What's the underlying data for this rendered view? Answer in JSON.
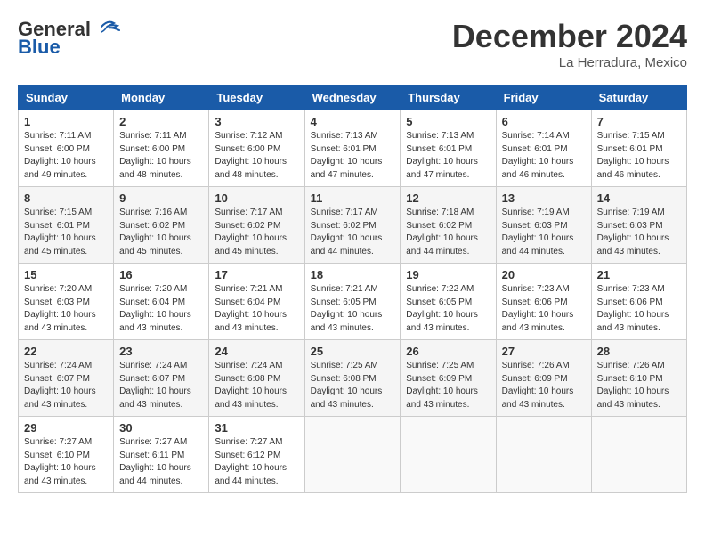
{
  "header": {
    "logo_general": "General",
    "logo_blue": "Blue",
    "month_title": "December 2024",
    "location": "La Herradura, Mexico"
  },
  "weekdays": [
    "Sunday",
    "Monday",
    "Tuesday",
    "Wednesday",
    "Thursday",
    "Friday",
    "Saturday"
  ],
  "weeks": [
    [
      {
        "day": "1",
        "info": "Sunrise: 7:11 AM\nSunset: 6:00 PM\nDaylight: 10 hours\nand 49 minutes."
      },
      {
        "day": "2",
        "info": "Sunrise: 7:11 AM\nSunset: 6:00 PM\nDaylight: 10 hours\nand 48 minutes."
      },
      {
        "day": "3",
        "info": "Sunrise: 7:12 AM\nSunset: 6:00 PM\nDaylight: 10 hours\nand 48 minutes."
      },
      {
        "day": "4",
        "info": "Sunrise: 7:13 AM\nSunset: 6:01 PM\nDaylight: 10 hours\nand 47 minutes."
      },
      {
        "day": "5",
        "info": "Sunrise: 7:13 AM\nSunset: 6:01 PM\nDaylight: 10 hours\nand 47 minutes."
      },
      {
        "day": "6",
        "info": "Sunrise: 7:14 AM\nSunset: 6:01 PM\nDaylight: 10 hours\nand 46 minutes."
      },
      {
        "day": "7",
        "info": "Sunrise: 7:15 AM\nSunset: 6:01 PM\nDaylight: 10 hours\nand 46 minutes."
      }
    ],
    [
      {
        "day": "8",
        "info": "Sunrise: 7:15 AM\nSunset: 6:01 PM\nDaylight: 10 hours\nand 45 minutes."
      },
      {
        "day": "9",
        "info": "Sunrise: 7:16 AM\nSunset: 6:02 PM\nDaylight: 10 hours\nand 45 minutes."
      },
      {
        "day": "10",
        "info": "Sunrise: 7:17 AM\nSunset: 6:02 PM\nDaylight: 10 hours\nand 45 minutes."
      },
      {
        "day": "11",
        "info": "Sunrise: 7:17 AM\nSunset: 6:02 PM\nDaylight: 10 hours\nand 44 minutes."
      },
      {
        "day": "12",
        "info": "Sunrise: 7:18 AM\nSunset: 6:02 PM\nDaylight: 10 hours\nand 44 minutes."
      },
      {
        "day": "13",
        "info": "Sunrise: 7:19 AM\nSunset: 6:03 PM\nDaylight: 10 hours\nand 44 minutes."
      },
      {
        "day": "14",
        "info": "Sunrise: 7:19 AM\nSunset: 6:03 PM\nDaylight: 10 hours\nand 43 minutes."
      }
    ],
    [
      {
        "day": "15",
        "info": "Sunrise: 7:20 AM\nSunset: 6:03 PM\nDaylight: 10 hours\nand 43 minutes."
      },
      {
        "day": "16",
        "info": "Sunrise: 7:20 AM\nSunset: 6:04 PM\nDaylight: 10 hours\nand 43 minutes."
      },
      {
        "day": "17",
        "info": "Sunrise: 7:21 AM\nSunset: 6:04 PM\nDaylight: 10 hours\nand 43 minutes."
      },
      {
        "day": "18",
        "info": "Sunrise: 7:21 AM\nSunset: 6:05 PM\nDaylight: 10 hours\nand 43 minutes."
      },
      {
        "day": "19",
        "info": "Sunrise: 7:22 AM\nSunset: 6:05 PM\nDaylight: 10 hours\nand 43 minutes."
      },
      {
        "day": "20",
        "info": "Sunrise: 7:23 AM\nSunset: 6:06 PM\nDaylight: 10 hours\nand 43 minutes."
      },
      {
        "day": "21",
        "info": "Sunrise: 7:23 AM\nSunset: 6:06 PM\nDaylight: 10 hours\nand 43 minutes."
      }
    ],
    [
      {
        "day": "22",
        "info": "Sunrise: 7:24 AM\nSunset: 6:07 PM\nDaylight: 10 hours\nand 43 minutes."
      },
      {
        "day": "23",
        "info": "Sunrise: 7:24 AM\nSunset: 6:07 PM\nDaylight: 10 hours\nand 43 minutes."
      },
      {
        "day": "24",
        "info": "Sunrise: 7:24 AM\nSunset: 6:08 PM\nDaylight: 10 hours\nand 43 minutes."
      },
      {
        "day": "25",
        "info": "Sunrise: 7:25 AM\nSunset: 6:08 PM\nDaylight: 10 hours\nand 43 minutes."
      },
      {
        "day": "26",
        "info": "Sunrise: 7:25 AM\nSunset: 6:09 PM\nDaylight: 10 hours\nand 43 minutes."
      },
      {
        "day": "27",
        "info": "Sunrise: 7:26 AM\nSunset: 6:09 PM\nDaylight: 10 hours\nand 43 minutes."
      },
      {
        "day": "28",
        "info": "Sunrise: 7:26 AM\nSunset: 6:10 PM\nDaylight: 10 hours\nand 43 minutes."
      }
    ],
    [
      {
        "day": "29",
        "info": "Sunrise: 7:27 AM\nSunset: 6:10 PM\nDaylight: 10 hours\nand 43 minutes."
      },
      {
        "day": "30",
        "info": "Sunrise: 7:27 AM\nSunset: 6:11 PM\nDaylight: 10 hours\nand 44 minutes."
      },
      {
        "day": "31",
        "info": "Sunrise: 7:27 AM\nSunset: 6:12 PM\nDaylight: 10 hours\nand 44 minutes."
      },
      null,
      null,
      null,
      null
    ]
  ]
}
